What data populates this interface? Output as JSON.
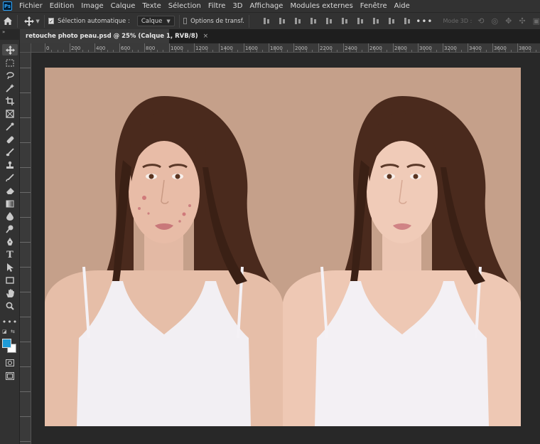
{
  "app": {
    "logo": "Ps"
  },
  "menu": [
    "Fichier",
    "Edition",
    "Image",
    "Calque",
    "Texte",
    "Sélection",
    "Filtre",
    "3D",
    "Affichage",
    "Modules externes",
    "Fenêtre",
    "Aide"
  ],
  "options": {
    "auto_select_label": "Sélection automatique :",
    "auto_select_checked": true,
    "target_value": "Calque",
    "transform_label": "Options de transf.",
    "transform_checked": false,
    "more": "•••",
    "mode3d_label": "Mode 3D :"
  },
  "document": {
    "tab_title": "retouche photo peau.psd @ 25% (Calque 1, RVB/8)",
    "close_glyph": "×"
  },
  "collapse_glyph": "»",
  "ruler_top_labels": [
    "0",
    "200",
    "400",
    "600",
    "800",
    "1000",
    "1200",
    "1400",
    "1600",
    "1800",
    "2000",
    "2200",
    "2400",
    "2600",
    "2800",
    "3000",
    "3200",
    "3400",
    "3600",
    "3800"
  ],
  "tools": [
    "move-tool",
    "marquee-tool",
    "lasso-tool",
    "magic-wand-tool",
    "crop-tool",
    "frame-tool",
    "eyedropper-tool",
    "healing-brush-tool",
    "brush-tool",
    "clone-stamp-tool",
    "history-brush-tool",
    "eraser-tool",
    "gradient-tool",
    "blur-tool",
    "dodge-tool",
    "pen-tool",
    "type-tool",
    "path-selection-tool",
    "rectangle-tool",
    "hand-tool",
    "zoom-tool",
    "more-tools"
  ],
  "tool_type_glyph": "T",
  "colors": {
    "foreground": "#1e9bd7",
    "background": "#ffffff",
    "canvas_bg": "#c5a08a",
    "ui_panel": "#323232"
  }
}
